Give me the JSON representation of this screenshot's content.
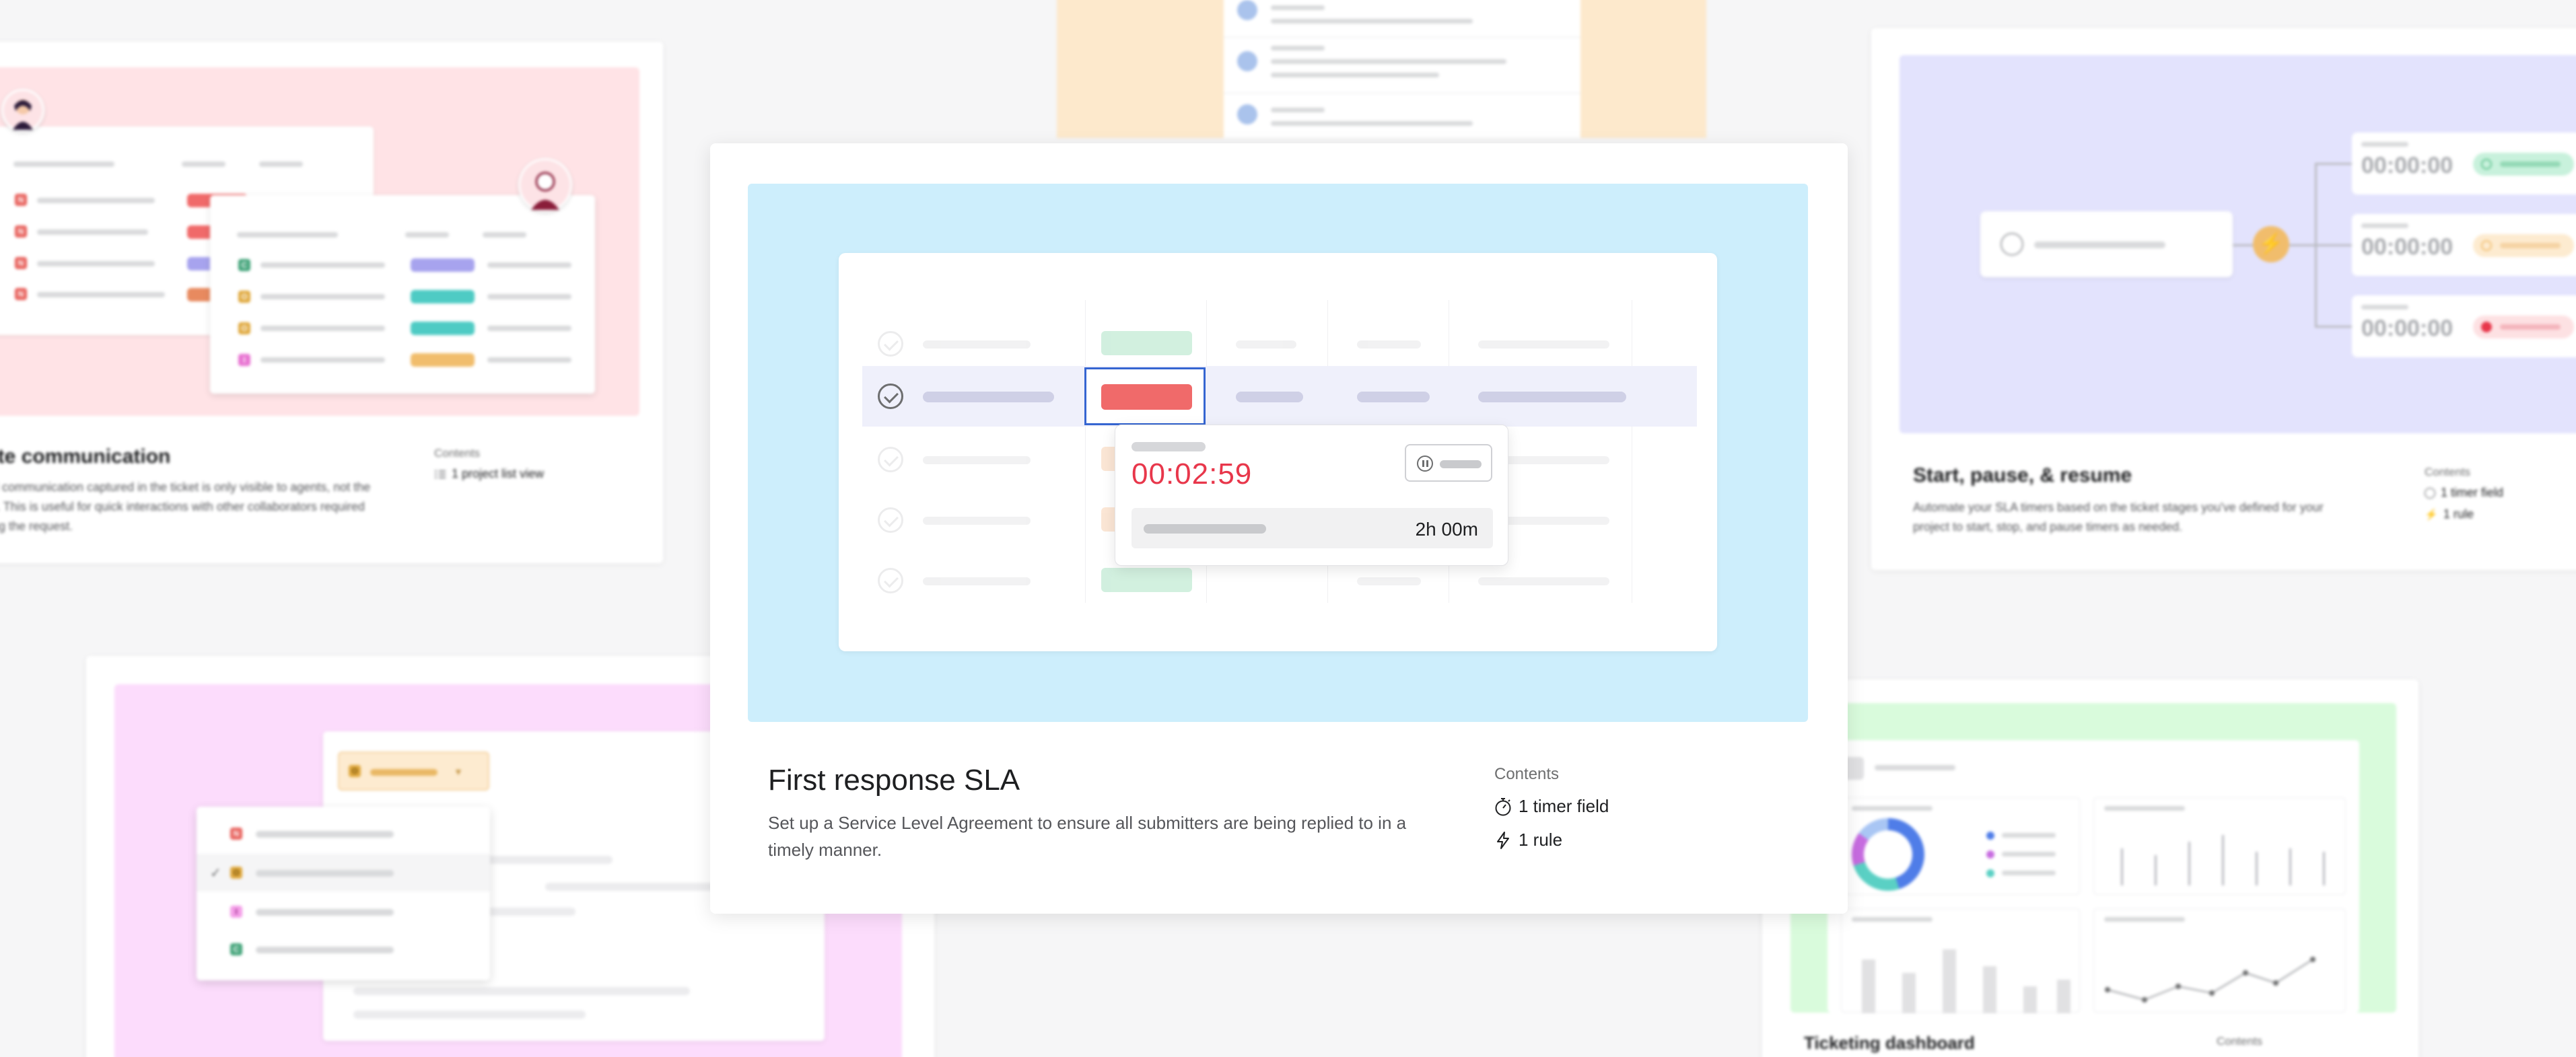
{
  "cards": {
    "top_left": {
      "title": "ate communication",
      "desc_lines": [
        "all communication captured in the ticket is only visible to agents, not the",
        "er. This is useful for quick interactions with other collaborators required",
        "ling the request."
      ],
      "contents_label": "Contents",
      "contents_items": [
        "1 project list view"
      ],
      "badge_letters": [
        "N",
        "N",
        "N",
        "N",
        "C",
        "O",
        "O",
        "I"
      ]
    },
    "featured": {
      "title": "First response SLA",
      "description": "Set up a Service Level Agreement to ensure all submitters are being replied to in a timely manner.",
      "contents_label": "Contents",
      "contents_items": [
        "1 timer field",
        "1 rule"
      ],
      "timer_value": "00:02:59",
      "target_time": "2h 00m"
    },
    "right": {
      "title": "Start, pause, & resume",
      "desc_lines": [
        "Automate your SLA timers based on the ticket stages you've defined for your",
        "project to start, stop, and pause timers as needed."
      ],
      "contents_label": "Contents",
      "contents_items": [
        "1 timer field",
        "1 rule"
      ],
      "timers": [
        "00:00:00",
        "00:00:00",
        "00:00:00"
      ]
    },
    "bottom_left": {
      "selected_badge": "O",
      "options": [
        "N",
        "O",
        "I",
        "C"
      ],
      "checkmark": "✓"
    },
    "bottom_right": {
      "title": "Ticketing dashboard",
      "contents_label": "Contents"
    }
  },
  "colors": {
    "accent_red": "#e8374b",
    "sky_bg": "#cdeefc",
    "lavender_bg": "#e3e3fd",
    "pink_bg": "#ffe3e6",
    "magenta_bg": "#fcdcfc",
    "mint_bg": "#d9fbdc",
    "peach_bg": "#fde9cc"
  },
  "icons": [
    "check-circle-icon",
    "pause-icon",
    "timer-icon",
    "lightning-icon",
    "list-view-icon",
    "play-icon",
    "stop-icon"
  ]
}
